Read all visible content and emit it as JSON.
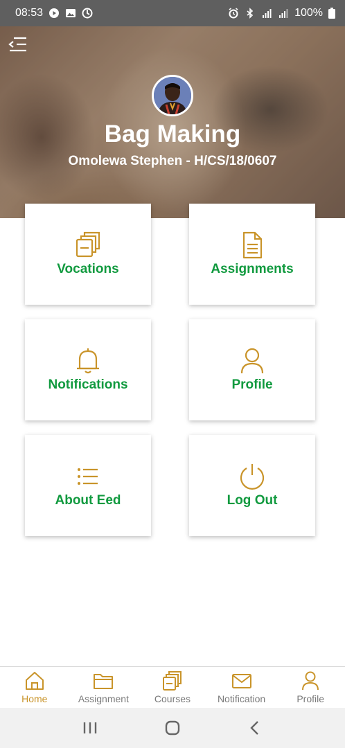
{
  "status_bar": {
    "time": "08:53",
    "battery": "100%"
  },
  "header": {
    "title": "Bag Making",
    "subtitle": "Omolewa Stephen - H/CS/18/0607"
  },
  "tiles": [
    {
      "label": "Vocations",
      "icon": "stacked-pages-icon"
    },
    {
      "label": "Assignments",
      "icon": "document-icon"
    },
    {
      "label": "Notifications",
      "icon": "bell-icon"
    },
    {
      "label": "Profile",
      "icon": "user-icon"
    },
    {
      "label": "About Eed",
      "icon": "list-icon"
    },
    {
      "label": "Log Out",
      "icon": "power-icon"
    }
  ],
  "bottom_nav": [
    {
      "label": "Home",
      "icon": "home-icon",
      "active": true
    },
    {
      "label": "Assignment",
      "icon": "folder-icon",
      "active": false
    },
    {
      "label": "Courses",
      "icon": "stacked-pages-icon",
      "active": false
    },
    {
      "label": "Notification",
      "icon": "envelope-icon",
      "active": false
    },
    {
      "label": "Profile",
      "icon": "user-icon",
      "active": false
    }
  ],
  "colors": {
    "accent_gold": "#c9942a",
    "label_green": "#119a3f",
    "inactive_gray": "#7a7a7a"
  }
}
